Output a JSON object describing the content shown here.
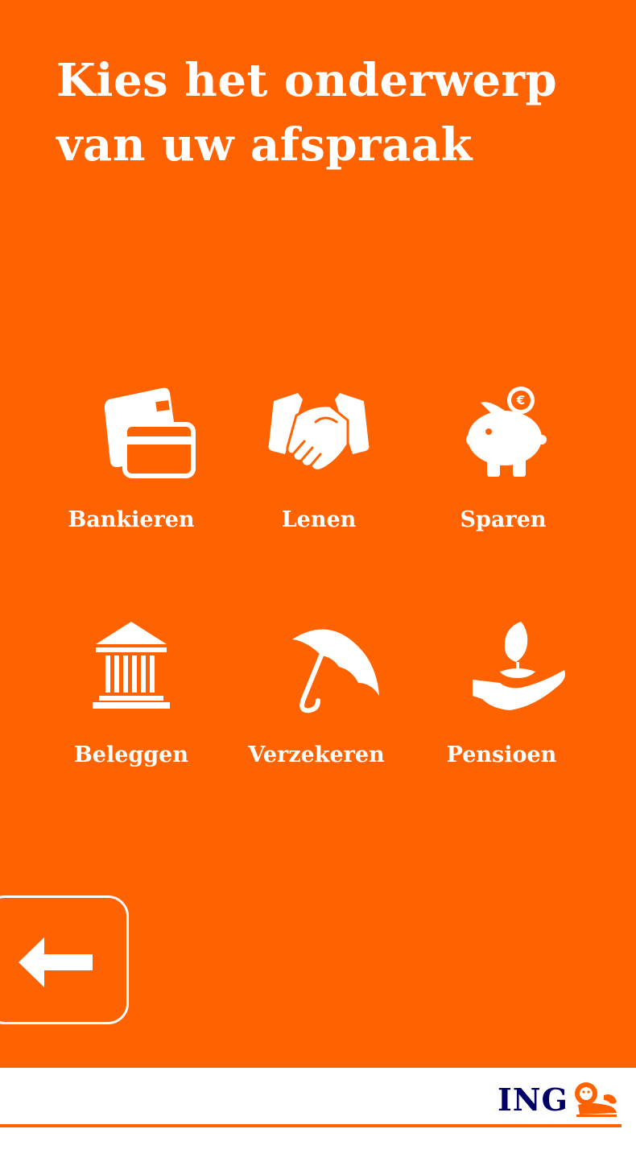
{
  "screen": {
    "title_line1": "Kies het onderwerp",
    "title_line2": "van uw afspraak"
  },
  "topics": [
    {
      "label": "Bankieren",
      "icon": "credit-cards-icon"
    },
    {
      "label": "Lenen",
      "icon": "handshake-icon"
    },
    {
      "label": "Sparen",
      "icon": "piggy-bank-icon"
    },
    {
      "label": "Beleggen",
      "icon": "bank-building-icon"
    },
    {
      "label": "Verzekeren",
      "icon": "umbrella-icon"
    },
    {
      "label": "Pensioen",
      "icon": "hand-plant-icon"
    }
  ],
  "navigation": {
    "back_icon": "arrow-left-icon"
  },
  "footer": {
    "brand_name": "ING",
    "brand_logo_icon": "ing-lion-icon"
  },
  "colors": {
    "accent": "#ff6200",
    "brand_navy": "#000066",
    "text_on_accent": "#ffffff",
    "footer_background": "#ffffff"
  }
}
